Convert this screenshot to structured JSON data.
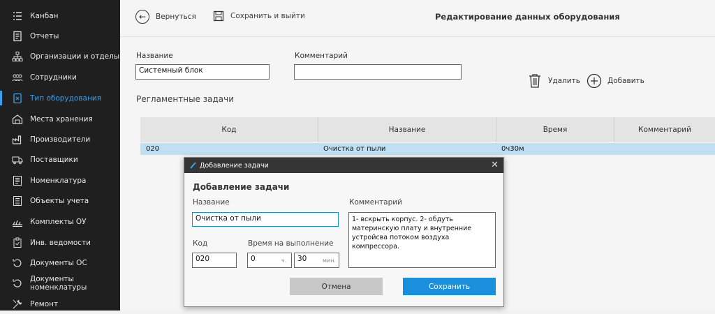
{
  "sidebar": {
    "items": [
      {
        "label": "Канбан",
        "icon": "kanban-icon"
      },
      {
        "label": "Отчеты",
        "icon": "report-icon"
      },
      {
        "label": "Организации и отделы",
        "icon": "org-icon"
      },
      {
        "label": "Сотрудники",
        "icon": "people-icon"
      },
      {
        "label": "Тип оборудования",
        "icon": "equipment-type-icon",
        "active": true
      },
      {
        "label": "Места хранения",
        "icon": "storage-icon"
      },
      {
        "label": "Производители",
        "icon": "factory-icon"
      },
      {
        "label": "Поставщики",
        "icon": "truck-icon"
      },
      {
        "label": "Номенклатура",
        "icon": "nomenclature-icon"
      },
      {
        "label": "Объекты учета",
        "icon": "objects-icon"
      },
      {
        "label": "Комплекты ОУ",
        "icon": "kits-icon"
      },
      {
        "label": "Инв. ведомости",
        "icon": "clipboard-icon"
      },
      {
        "label": "Документы ОС",
        "icon": "doc-os-icon"
      },
      {
        "label": "Документы номенклатуры",
        "icon": "doc-nom-icon"
      },
      {
        "label": "Ремонт",
        "icon": "repair-icon"
      }
    ]
  },
  "topbar": {
    "back_label": "Вернуться",
    "save_exit_label": "Сохранить и выйти",
    "title": "Редактирование данных оборудования"
  },
  "form": {
    "name_label": "Название",
    "name_value": "Системный блок",
    "comment_label": "Комментарий",
    "comment_value": ""
  },
  "actions": {
    "delete_label": "Удалить",
    "add_label": "Добавить"
  },
  "tasks": {
    "section_title": "Регламентные задачи",
    "columns": [
      "Код",
      "Название",
      "Время",
      "Комментарий"
    ],
    "rows": [
      {
        "code": "020",
        "name": "Очистка от пыли",
        "time": "0ч30м",
        "comment": ""
      }
    ]
  },
  "dialog": {
    "window_title": "Добавление задачи",
    "heading": "Добавление задачи",
    "name_label": "Название",
    "name_value": "Очистка от пыли",
    "comment_label": "Комментарий",
    "comment_value": "1- вскрыть корпус. 2- обдуть материнскую плату и внутренние устройсва потоком воздуха компрессора.",
    "code_label": "Код",
    "code_value": "020",
    "time_label": "Время на выполнение",
    "hours_value": "0",
    "hours_unit": "ч.",
    "minutes_value": "30",
    "minutes_unit": "мин.",
    "cancel_label": "Отмена",
    "save_label": "Сохранить"
  },
  "colors": {
    "sidebar_bg": "#1f1f1f",
    "accent": "#1a8fdc",
    "selected_row": "#bfe0f4"
  }
}
